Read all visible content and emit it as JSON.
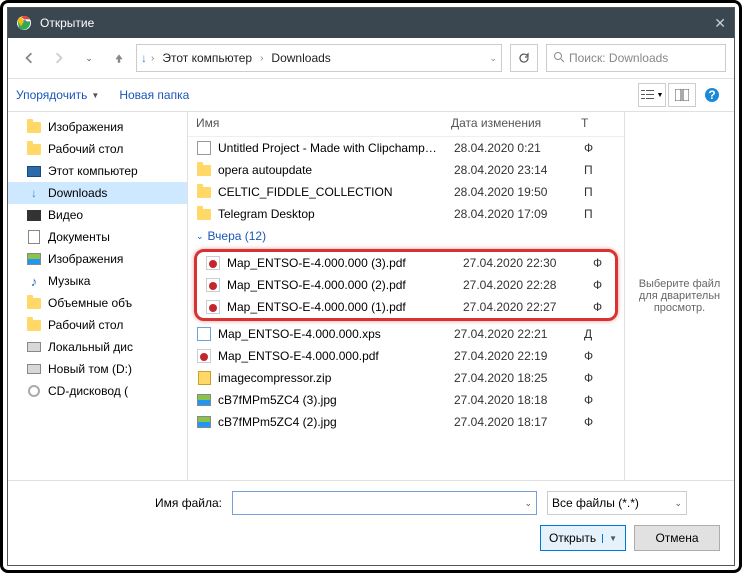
{
  "title": "Открытие",
  "breadcrumb": {
    "pc": "Этот компьютер",
    "folder": "Downloads"
  },
  "search_placeholder": "Поиск: Downloads",
  "toolbar": {
    "organize": "Упорядочить",
    "newfolder": "Новая папка"
  },
  "columns": {
    "name": "Имя",
    "date": "Дата изменения",
    "type": "Т"
  },
  "sidebar": [
    {
      "label": "Изображения",
      "icon": "folder"
    },
    {
      "label": "Рабочий стол",
      "icon": "folder"
    },
    {
      "label": "Этот компьютер",
      "icon": "pc"
    },
    {
      "label": "Downloads",
      "icon": "down",
      "selected": true
    },
    {
      "label": "Видео",
      "icon": "vid"
    },
    {
      "label": "Документы",
      "icon": "doc"
    },
    {
      "label": "Изображения",
      "icon": "img"
    },
    {
      "label": "Музыка",
      "icon": "music"
    },
    {
      "label": "Объемные объ",
      "icon": "folder"
    },
    {
      "label": "Рабочий стол",
      "icon": "folder"
    },
    {
      "label": "Локальный дис",
      "icon": "hdd"
    },
    {
      "label": "Новый том (D:)",
      "icon": "hdd"
    },
    {
      "label": "CD-дисковод (",
      "icon": "cd"
    }
  ],
  "group_header": "Вчера (12)",
  "files_top": [
    {
      "name": "Untitled Project - Made with Clipchamp…",
      "date": "28.04.2020 0:21",
      "type": "Ф",
      "icon": "clip"
    },
    {
      "name": "opera autoupdate",
      "date": "28.04.2020 23:14",
      "type": "П",
      "icon": "folder"
    },
    {
      "name": "CELTIC_FIDDLE_COLLECTION",
      "date": "28.04.2020 19:50",
      "type": "П",
      "icon": "folder"
    },
    {
      "name": "Telegram Desktop",
      "date": "28.04.2020 17:09",
      "type": "П",
      "icon": "folder"
    }
  ],
  "files_highlight": [
    {
      "name": "Map_ENTSO-E-4.000.000 (3).pdf",
      "date": "27.04.2020 22:30",
      "type": "Ф",
      "icon": "pdf"
    },
    {
      "name": "Map_ENTSO-E-4.000.000 (2).pdf",
      "date": "27.04.2020 22:28",
      "type": "Ф",
      "icon": "pdf"
    },
    {
      "name": "Map_ENTSO-E-4.000.000 (1).pdf",
      "date": "27.04.2020 22:27",
      "type": "Ф",
      "icon": "pdf"
    }
  ],
  "files_bottom": [
    {
      "name": "Map_ENTSO-E-4.000.000.xps",
      "date": "27.04.2020 22:21",
      "type": "Д",
      "icon": "xps"
    },
    {
      "name": "Map_ENTSO-E-4.000.000.pdf",
      "date": "27.04.2020 22:19",
      "type": "Ф",
      "icon": "pdf"
    },
    {
      "name": "imagecompressor.zip",
      "date": "27.04.2020 18:25",
      "type": "Ф",
      "icon": "zip"
    },
    {
      "name": "cB7fMPm5ZC4 (3).jpg",
      "date": "27.04.2020 18:18",
      "type": "Ф",
      "icon": "img"
    },
    {
      "name": "cB7fMPm5ZC4 (2).jpg",
      "date": "27.04.2020 18:17",
      "type": "Ф",
      "icon": "img"
    }
  ],
  "preview_text": "Выберите файл для дварительн просмотр.",
  "footer": {
    "filename_label": "Имя файла:",
    "filename_value": "",
    "filter": "Все файлы (*.*)",
    "open": "Открыть",
    "cancel": "Отмена"
  }
}
